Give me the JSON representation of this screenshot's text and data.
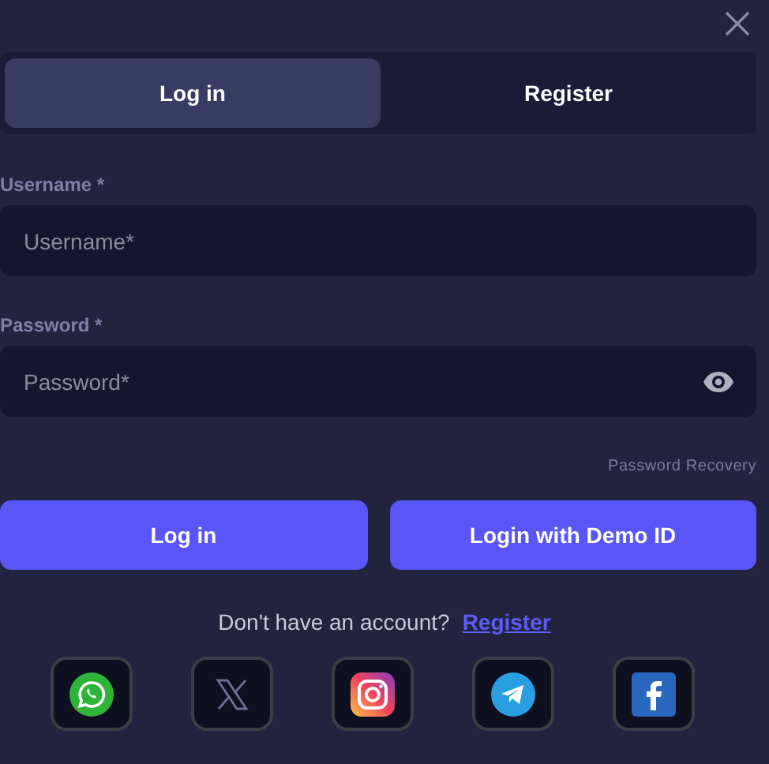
{
  "tabs": [
    {
      "label": "Log in",
      "selected": true
    },
    {
      "label": "Register",
      "selected": false
    }
  ],
  "fields": [
    {
      "label": "Username *",
      "placeholder": "Username*",
      "kind": "text"
    },
    {
      "label": "Password *",
      "placeholder": "Password*",
      "kind": "password"
    }
  ],
  "password_recovery": "Password Recovery",
  "buttons": [
    "Log in",
    "Login with Demo ID"
  ],
  "signup_prompt": {
    "text": "Don't have an account?",
    "link": "Register"
  },
  "social": [
    {
      "kind": "whatsapp"
    },
    {
      "kind": "x"
    },
    {
      "kind": "instagram"
    },
    {
      "kind": "telegram"
    },
    {
      "kind": "facebook"
    }
  ]
}
